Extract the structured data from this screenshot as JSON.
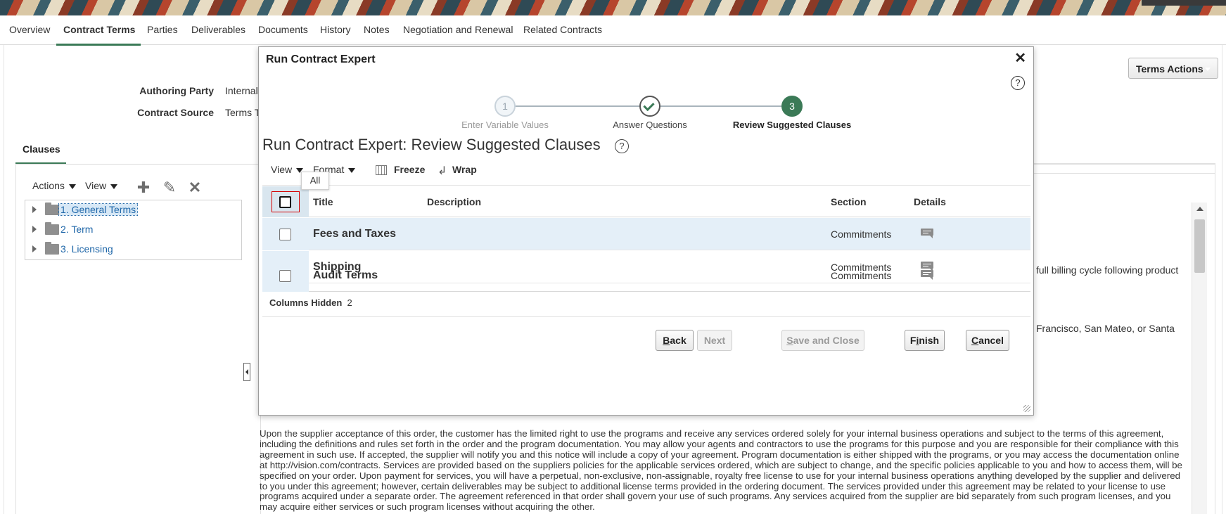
{
  "tabs": [
    {
      "label": "Overview"
    },
    {
      "label": "Contract Terms",
      "active": true
    },
    {
      "label": "Parties"
    },
    {
      "label": "Deliverables"
    },
    {
      "label": "Documents"
    },
    {
      "label": "History"
    },
    {
      "label": "Notes"
    },
    {
      "label": "Negotiation and Renewal"
    },
    {
      "label": "Related Contracts"
    }
  ],
  "header": {
    "terms_actions_label": "Terms Actions",
    "authoring_party_label": "Authoring Party",
    "authoring_party_value": "Internal",
    "contract_source_label": "Contract Source",
    "contract_source_value": "Terms T"
  },
  "clauses_panel": {
    "tab_label": "Clauses",
    "actions_label": "Actions",
    "view_label": "View",
    "tree": [
      {
        "label": "1. General Terms",
        "selected": true
      },
      {
        "label": "2. Term"
      },
      {
        "label": "3. Licensing"
      }
    ]
  },
  "background_text": {
    "fragment_1": "full billing cycle following product",
    "fragment_2": "Francisco, San Mateo, or Santa",
    "paragraph": "Upon the supplier acceptance of this order, the customer has the limited right to use the programs and receive any services ordered solely for your internal business operations and subject to the terms of this agreement, including the definitions and rules set forth in the order and the program documentation. You may allow your agents and contractors to use the programs for this purpose and you are responsible for their compliance with this agreement in such use. If accepted, the supplier will notify you and this notice will include a copy of your agreement. Program documentation is either shipped with the programs, or you may access the documentation online at http://vision.com/contracts. Services are provided based on the suppliers policies for the applicable services ordered, which are subject to change, and the specific policies applicable to you and how to access them, will be specified on your order. Upon payment for services, you will have a perpetual, non-exclusive, non-assignable, royalty free license to use for your internal business operations anything developed by the supplier and delivered to you under this agreement; however, certain deliverables may be subject to additional license terms provided in the ordering document. The services provided under this agreement may be related to your license to use programs acquired under a separate order. The agreement referenced in that order shall govern your use of such programs. Any services acquired from the supplier are bid separately from such program licenses, and you may acquire either services or such program licenses without acquiring the other."
  },
  "dialog": {
    "title": "Run Contract Expert",
    "close_glyph": "✕",
    "help_glyph": "?",
    "steps": [
      {
        "number": "1",
        "label": "Enter Variable Values"
      },
      {
        "number": "",
        "label": "Answer Questions"
      },
      {
        "number": "3",
        "label": "Review Suggested Clauses"
      }
    ],
    "heading": "Run Contract Expert: Review Suggested Clauses",
    "toolbar": {
      "view": "View",
      "format": "Format",
      "freeze": "Freeze",
      "wrap": "Wrap"
    },
    "tooltip": "All",
    "columns": {
      "title": "Title",
      "description": "Description",
      "section": "Section",
      "details": "Details"
    },
    "rows": [
      {
        "title": "Fees and Taxes",
        "section": "Commitments"
      },
      {
        "title": "Shipping",
        "section": "Commitments"
      },
      {
        "title": "Audit Terms",
        "section": "Commitments"
      }
    ],
    "columns_hidden_label": "Columns Hidden",
    "columns_hidden_count": "2",
    "buttons": {
      "back_first": "B",
      "back_rest": "ack",
      "next": "Next",
      "save_first": "S",
      "save_rest": "ave and Close",
      "finish_a": "F",
      "finish_b": "i",
      "finish_c": "nish",
      "cancel_first": "C",
      "cancel_rest": "ancel"
    }
  },
  "colors": {
    "accent_green": "#3b7a57",
    "link_blue": "#1e66a8",
    "selection_bg": "#d9e6ef",
    "row_highlight": "#e4eff8"
  }
}
